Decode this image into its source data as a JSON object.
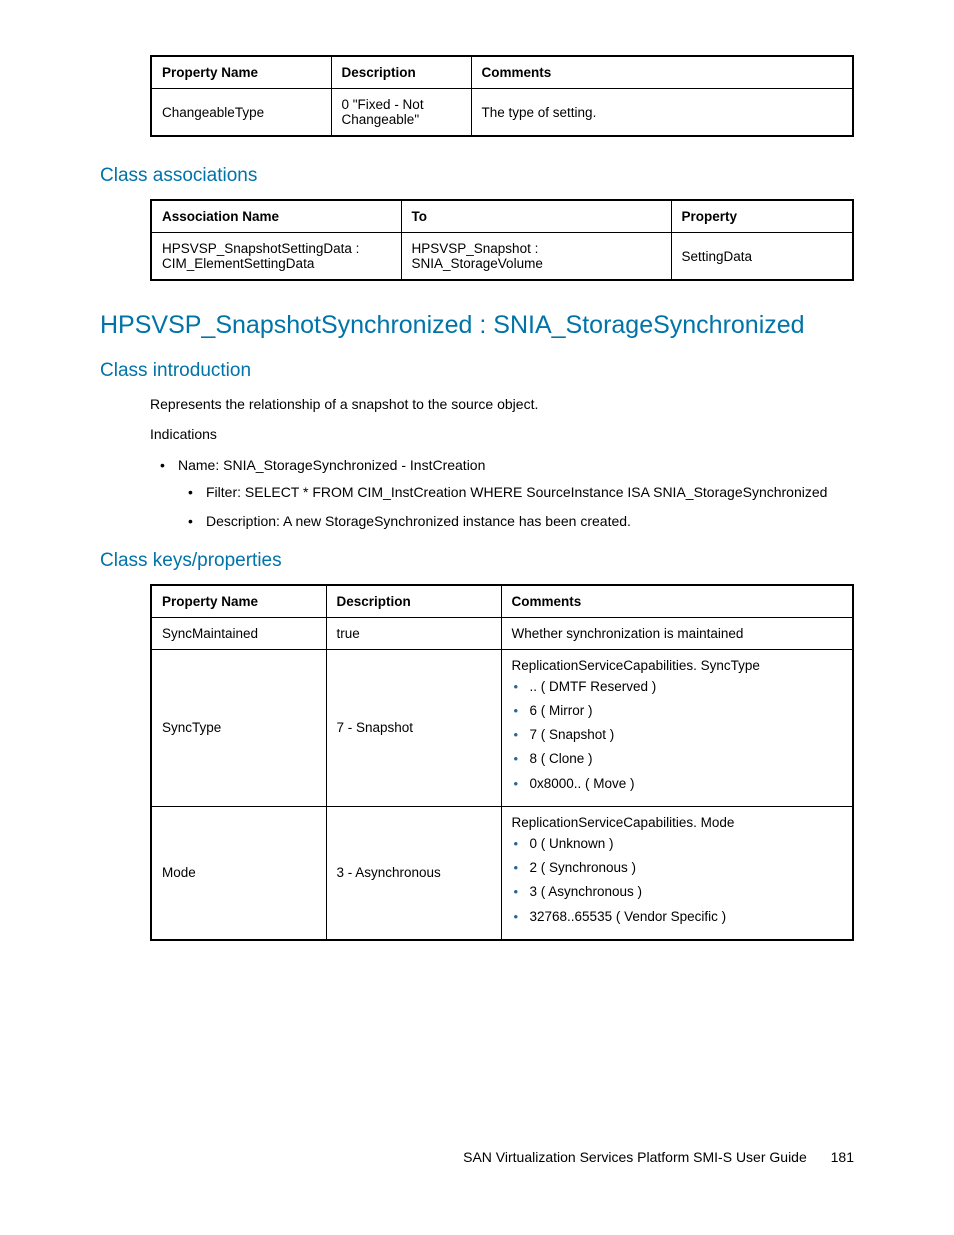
{
  "table1": {
    "headers": [
      "Property Name",
      "Description",
      "Comments"
    ],
    "row": {
      "name": "ChangeableType",
      "desc": "0 \"Fixed - Not Changeable\"",
      "comment": "The type of setting."
    }
  },
  "section_assoc_title": "Class associations",
  "table2": {
    "headers": [
      "Association Name",
      "To",
      "Property"
    ],
    "row": {
      "name": "HPSVSP_SnapshotSettingData : CIM_ElementSettingData",
      "to": "HPSVSP_Snapshot : SNIA_StorageVolume",
      "prop": "SettingData"
    }
  },
  "main_title": "HPSVSP_SnapshotSynchronized : SNIA_StorageSynchronized",
  "intro_title": "Class introduction",
  "intro_para": "Represents the relationship of a snapshot to the source object.",
  "indications_label": "Indications",
  "ind_name": "Name: SNIA_StorageSynchronized - InstCreation",
  "ind_filter": "Filter: SELECT * FROM CIM_InstCreation WHERE SourceInstance ISA SNIA_StorageSynchronized",
  "ind_desc": "Description: A new StorageSynchronized instance has been created.",
  "keys_title": "Class keys/properties",
  "table3": {
    "headers": [
      "Property Name",
      "Description",
      "Comments"
    ],
    "rows": [
      {
        "name": "SyncMaintained",
        "desc": "true",
        "comment_title": "Whether synchronization is maintained",
        "list": []
      },
      {
        "name": "SyncType",
        "desc": "7 - Snapshot",
        "comment_title": "ReplicationServiceCapabilities. SyncType",
        "list": [
          ".. ( DMTF Reserved )",
          "6 ( Mirror )",
          "7 ( Snapshot )",
          "8 ( Clone )",
          "0x8000.. ( Move )"
        ]
      },
      {
        "name": "Mode",
        "desc": "3 - Asynchronous",
        "comment_title": "ReplicationServiceCapabilities. Mode",
        "list": [
          "0 ( Unknown )",
          "2 ( Synchronous )",
          "3 ( Asynchronous )",
          "32768..65535 ( Vendor Specific )"
        ]
      }
    ]
  },
  "footer_text": "SAN Virtualization Services Platform SMI-S User Guide",
  "footer_page": "181"
}
